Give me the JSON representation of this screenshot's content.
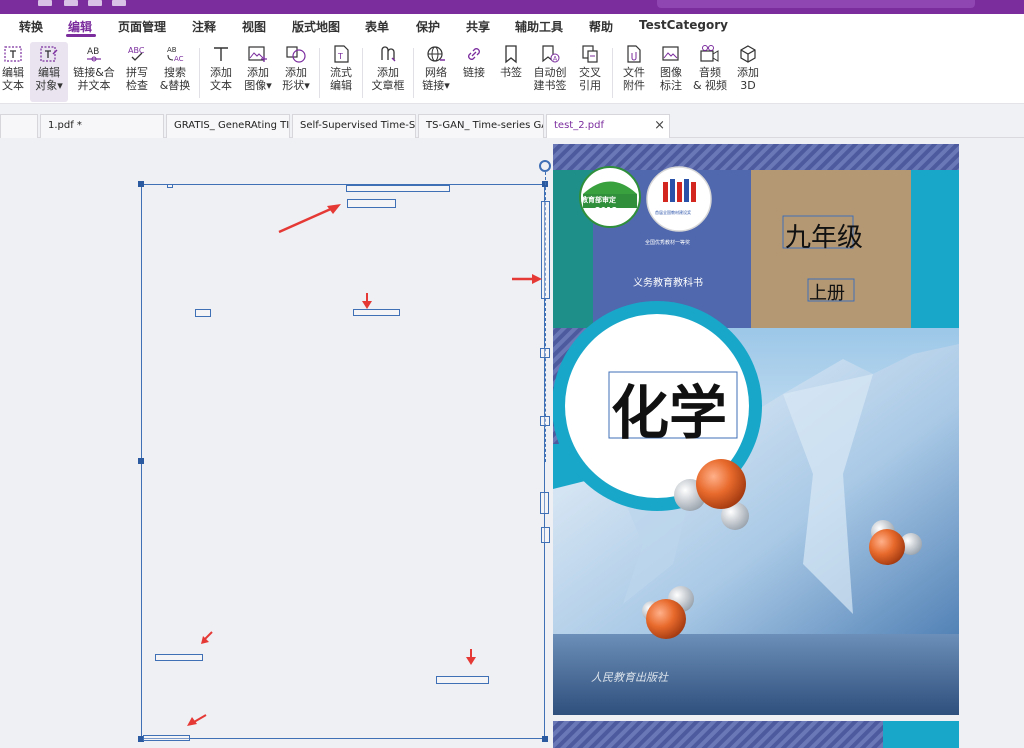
{
  "menu": {
    "items": [
      {
        "label": "转换",
        "active": false
      },
      {
        "label": "编辑",
        "active": true
      },
      {
        "label": "页面管理",
        "active": false
      },
      {
        "label": "注释",
        "active": false
      },
      {
        "label": "视图",
        "active": false
      },
      {
        "label": "版式地图",
        "active": false
      },
      {
        "label": "表单",
        "active": false
      },
      {
        "label": "保护",
        "active": false
      },
      {
        "label": "共享",
        "active": false
      },
      {
        "label": "辅助工具",
        "active": false
      },
      {
        "label": "帮助",
        "active": false
      },
      {
        "label": "TestCategory",
        "active": false
      }
    ]
  },
  "ribbon": {
    "tools": [
      {
        "l1": "编辑",
        "l2": "文本",
        "icon": "edit-text-icon"
      },
      {
        "l1": "编辑",
        "l2": "对象▾",
        "icon": "edit-object-icon"
      },
      {
        "l1": "链接&合",
        "l2": "并文本",
        "icon": "link-merge-text-icon"
      },
      {
        "l1": "拼写",
        "l2": "检查",
        "icon": "spell-check-icon"
      },
      {
        "l1": "搜索",
        "l2": "&替换",
        "icon": "search-replace-icon"
      },
      {
        "l1": "添加",
        "l2": "文本",
        "icon": "add-text-icon"
      },
      {
        "l1": "添加",
        "l2": "图像▾",
        "icon": "add-image-icon"
      },
      {
        "l1": "添加",
        "l2": "形状▾",
        "icon": "add-shape-icon"
      },
      {
        "l1": "流式",
        "l2": "编辑",
        "icon": "flow-edit-icon"
      },
      {
        "l1": "添加",
        "l2": "文章框",
        "icon": "add-article-box-icon"
      },
      {
        "l1": "网络",
        "l2": "链接▾",
        "icon": "web-link-icon"
      },
      {
        "l1": "链接",
        "l2": "",
        "icon": "link-icon"
      },
      {
        "l1": "书签",
        "l2": "",
        "icon": "bookmark-icon"
      },
      {
        "l1": "自动创",
        "l2": "建书签",
        "icon": "auto-bookmark-icon"
      },
      {
        "l1": "交叉",
        "l2": "引用",
        "icon": "cross-reference-icon"
      },
      {
        "l1": "文件",
        "l2": "附件",
        "icon": "file-attachment-icon"
      },
      {
        "l1": "图像",
        "l2": "标注",
        "icon": "image-annotation-icon"
      },
      {
        "l1": "音频",
        "l2": "& 视频",
        "icon": "audio-video-icon"
      },
      {
        "l1": "添加",
        "l2": "3D",
        "icon": "add-3d-icon"
      }
    ]
  },
  "tabs": [
    {
      "label": "",
      "active": false
    },
    {
      "label": "1.pdf *",
      "active": false
    },
    {
      "label": "GRATIS_ GeneRAting TI...",
      "active": false
    },
    {
      "label": "Self-Supervised Time-Se...",
      "active": false
    },
    {
      "label": "TS-GAN_ Time-series GA...",
      "active": false
    },
    {
      "label": "test_2.pdf",
      "active": true
    }
  ],
  "cover": {
    "seal_top": "教育部审定",
    "seal_year": "2012",
    "award_text": "首届全国教材建设奖",
    "award_caption": "全国优秀教材一等奖",
    "series": "义务教育教科书",
    "grade": "九年级",
    "volume": "上册",
    "subject": "化学",
    "publisher": "人民教育出版社"
  },
  "colors": {
    "accent": "#7b2d9e",
    "selection": "#3f6fb5",
    "arrow": "#e53935"
  }
}
